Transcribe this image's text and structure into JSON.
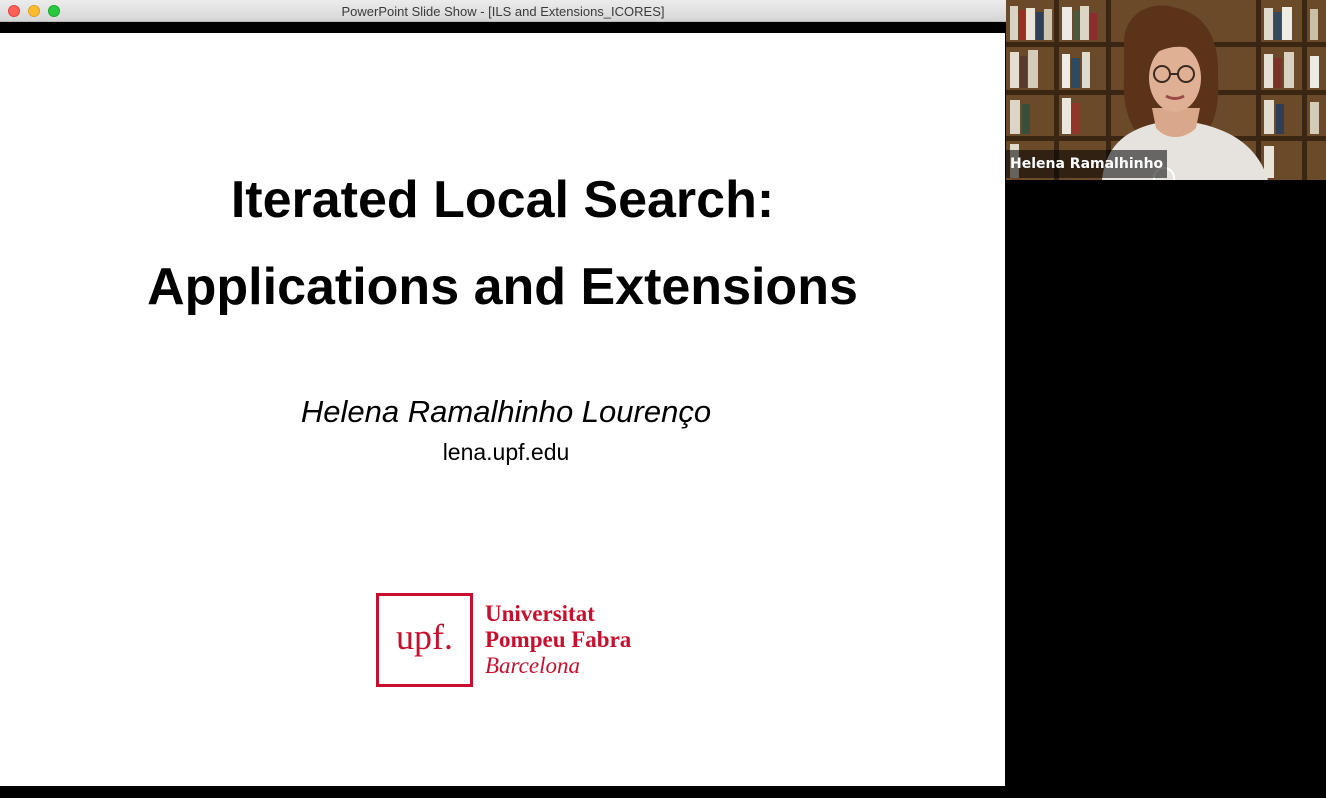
{
  "window": {
    "title": "PowerPoint Slide Show - [ILS and Extensions_ICORES]"
  },
  "slide": {
    "title_line1": "Iterated Local Search:",
    "title_line2": "Applications and Extensions",
    "author": "Helena Ramalhinho Lourenço",
    "email": "lena.upf.edu",
    "logo": {
      "mark": "upf.",
      "line1": "Universitat",
      "line2": "Pompeu Fabra",
      "line3": "Barcelona"
    }
  },
  "video": {
    "participant_name": "Helena Ramalhinho"
  },
  "colors": {
    "brand_red": "#c8102e"
  }
}
